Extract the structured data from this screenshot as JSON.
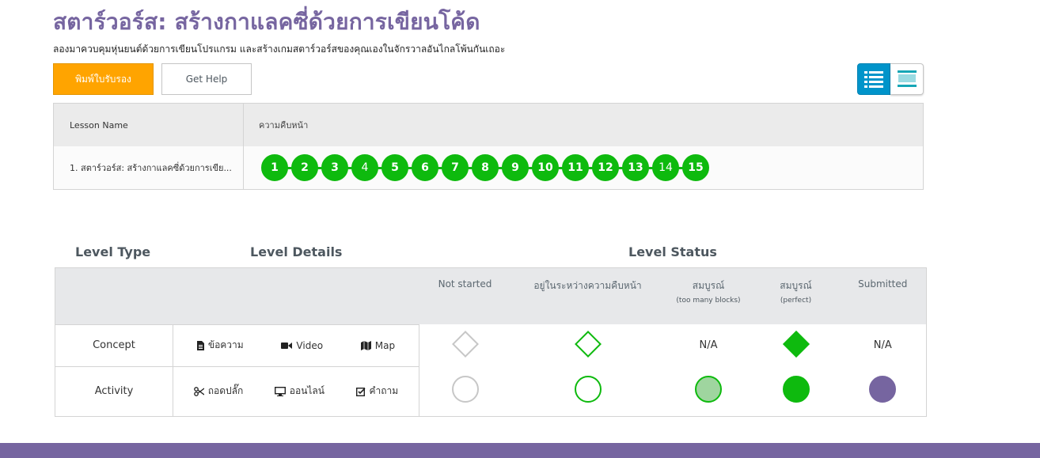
{
  "header": {
    "title": "สตาร์วอร์ส: สร้างกาแลคซี่ด้วยการเขียนโค้ด",
    "subtitle": "ลองมาควบคุมหุ่นยนต์ด้วยการเขียนโปรแกรม และสร้างเกมสตาร์วอร์สของคุณเองในจักรวาลอันไกลโพ้นกันเถอะ",
    "print_button": "พิมพ์ใบรับรอง",
    "help_button": "Get Help"
  },
  "view_toggle": {
    "list_icon": "list-view-icon",
    "detail_icon": "detail-view-icon",
    "active_color": "#0094ca"
  },
  "progress_table": {
    "col_lesson": "Lesson Name",
    "col_progress": "ความคืบหน้า",
    "lesson_name": "1. สตาร์วอร์ส: สร้างกาแลคซี่ด้วยการเขีย...",
    "levels": [
      "1",
      "2",
      "3",
      "4",
      "5",
      "6",
      "7",
      "8",
      "9",
      "10",
      "11",
      "12",
      "13",
      "14",
      "15"
    ]
  },
  "legend": {
    "level_type": "Level Type",
    "level_details": "Level Details",
    "level_status": "Level Status",
    "statuses": [
      {
        "label": "Not started",
        "sub": ""
      },
      {
        "label": "อยู่ในระหว่างความคืบหน้า",
        "sub": ""
      },
      {
        "label": "สมบูรณ์",
        "sub": "(too many blocks)"
      },
      {
        "label": "สมบูรณ์",
        "sub": "(perfect)"
      },
      {
        "label": "Submitted",
        "sub": ""
      }
    ],
    "concept": {
      "label": "Concept",
      "details": [
        {
          "icon": "document-icon",
          "label": "ข้อความ"
        },
        {
          "icon": "video-camera-icon",
          "label": "Video"
        },
        {
          "icon": "map-icon",
          "label": "Map"
        }
      ],
      "na1": "N/A",
      "na2": "N/A"
    },
    "activity": {
      "label": "Activity",
      "details": [
        {
          "icon": "scissors-icon",
          "label": "ถอดปลั๊ก"
        },
        {
          "icon": "desktop-icon",
          "label": "ออนไลน์"
        },
        {
          "icon": "checkbox-icon",
          "label": "คำถาม"
        }
      ]
    }
  },
  "colors": {
    "brand_purple": "#7665a0",
    "success_green": "#0eba0e",
    "print_orange": "#ffa400"
  }
}
